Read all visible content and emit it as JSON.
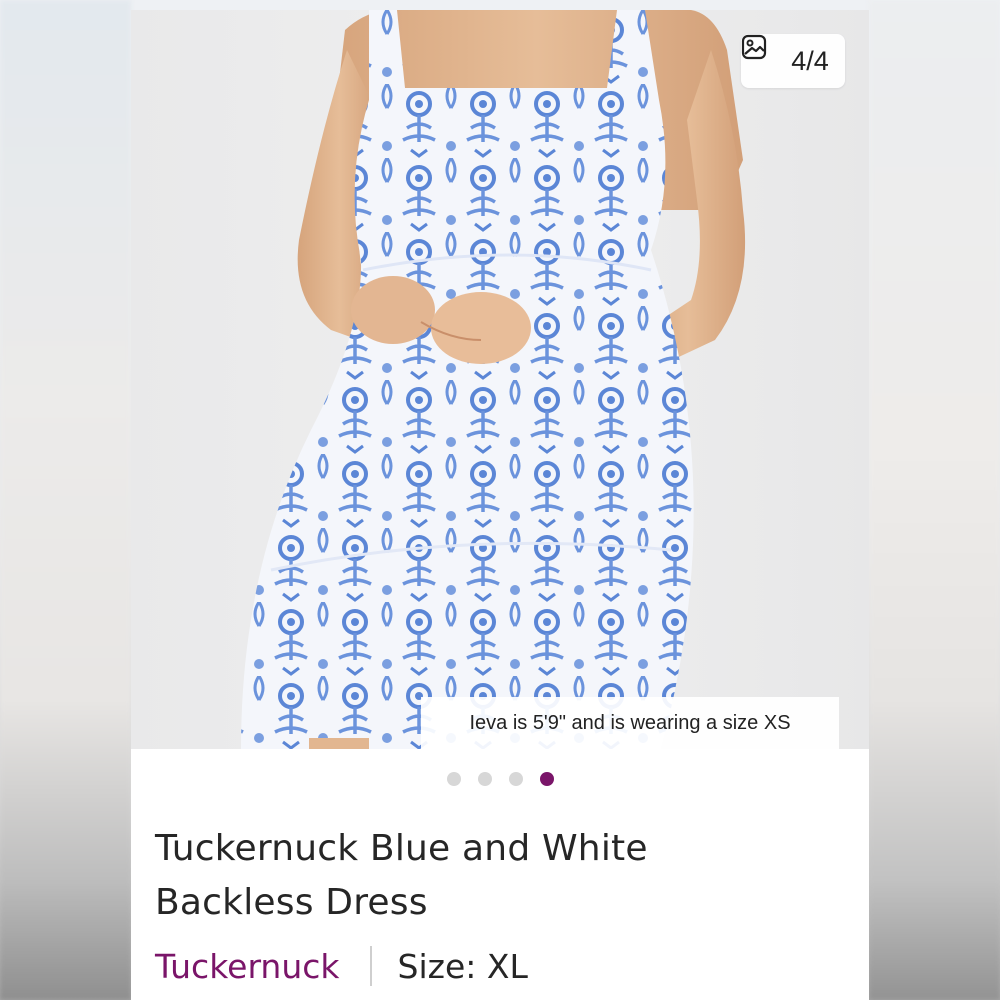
{
  "gallery": {
    "counter": "4/4",
    "counter_icon": "image-icon",
    "caption": "Ieva is 5'9\" and is wearing a size XS",
    "total_images": 4,
    "active_index": 3
  },
  "listing": {
    "title_line1": "Tuckernuck Blue and White",
    "title_line2": "Backless Dress",
    "brand": "Tuckernuck",
    "size_label": "Size: XL"
  },
  "colors": {
    "accent": "#7a1569",
    "pattern_blue": "#5b86d6",
    "dress_white": "#f4f6fb",
    "skin": "#e0b48f"
  }
}
